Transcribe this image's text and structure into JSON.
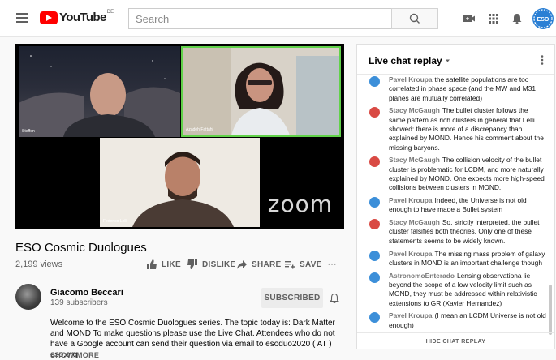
{
  "header": {
    "logo_text": "YouTube",
    "region_code": "DE",
    "search_placeholder": "Search",
    "icons": [
      "menu-icon",
      "youtube-logo",
      "search-icon",
      "create-video-icon",
      "apps-icon",
      "notifications-icon",
      "account-avatar"
    ],
    "avatar_text": "ESO"
  },
  "video": {
    "participants": [
      {
        "name": "Steffen"
      },
      {
        "name": "Azadeh Fattahi"
      },
      {
        "name": "Federico Lelli"
      }
    ],
    "watermark": "zoom",
    "title": "ESO Cosmic Duologues",
    "views": "2,199 views",
    "actions": {
      "like": "LIKE",
      "dislike": "DISLIKE",
      "share": "SHARE",
      "save": "SAVE",
      "more": "···"
    }
  },
  "channel": {
    "name": "Giacomo Beccari",
    "subscribers": "139 subscribers",
    "subscribe_label": "SUBSCRIBED",
    "description": "Welcome to the ESO Cosmic Duologues series. The topic today is: Dark Matter and MOND To make questions please use the Live Chat. Attendees who do not have a Google account can send their question via email to esoduo2020 ( AT ) eso.org",
    "show_more": "SHOW MORE"
  },
  "chat": {
    "title": "Live chat replay",
    "footer": "HIDE CHAT REPLAY",
    "messages": [
      {
        "author": "Pavel Kroupa",
        "avatar_color": "#3c8fd9",
        "text": "the satellite populations are too correlated in phase space (and the MW and M31 planes are mutually correlated)"
      },
      {
        "author": "Stacy McGaugh",
        "avatar_color": "#d94a44",
        "text": "The bullet cluster follows the same pattern as rich clusters in general that Lelli showed: there is more of a discrepancy than explained by MOND. Hence his comment about the missing baryons."
      },
      {
        "author": "Stacy McGaugh",
        "avatar_color": "#d94a44",
        "text": "The collision velocity of the bullet cluster is problematic for LCDM, and more naturally explained by MOND. One expects more high-speed collisions between clusters in MOND."
      },
      {
        "author": "Pavel Kroupa",
        "avatar_color": "#3c8fd9",
        "text": "Indeed, the Universe is not old enough to have made a Bullet system"
      },
      {
        "author": "Stacy McGaugh",
        "avatar_color": "#d94a44",
        "text": "So, strictly interpreted, the bullet cluster falsifies both theories. Only one of these statements seems to be widely known."
      },
      {
        "author": "Pavel Kroupa",
        "avatar_color": "#3c8fd9",
        "text": "The missing mass problem of galaxy clusters in MOND is an important challenge though"
      },
      {
        "author": "AstronomoEnterado",
        "avatar_color": "#3c8fd9",
        "text": "Lensing observationa lie beyond the scope of a low velocity limit such as MOND, they must be addressed within relativistic extensions to GR (Xavier Hernandez)"
      },
      {
        "author": "Pavel Kroupa",
        "avatar_color": "#3c8fd9",
        "text": "(I mean an LCDM Universe is not old enough)"
      }
    ]
  }
}
